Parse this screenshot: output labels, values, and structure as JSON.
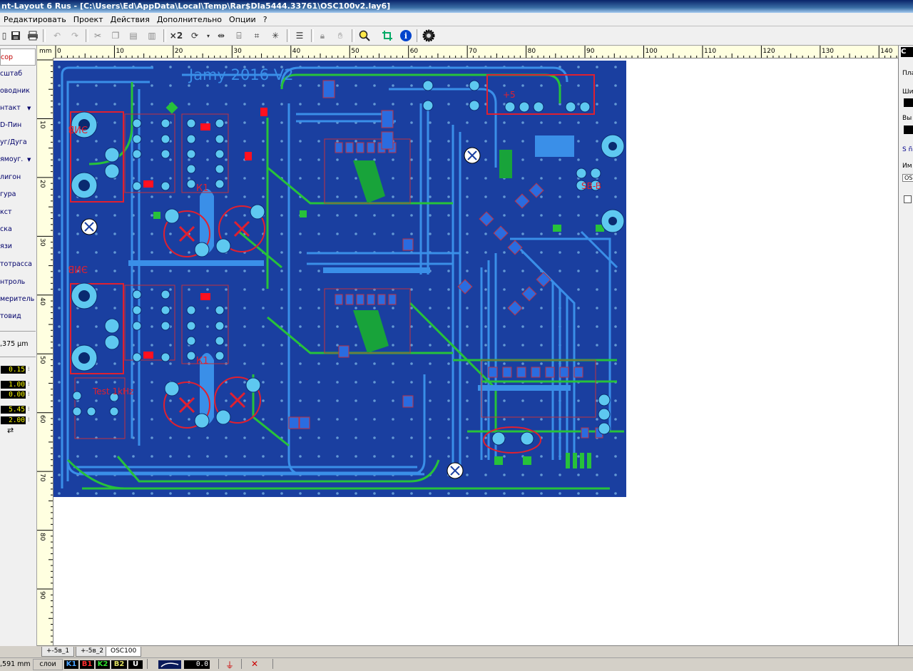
{
  "window": {
    "title": "nt-Layout 6 Rus - [C:\\Users\\Ed\\AppData\\Local\\Temp\\Rar$DIa5444.33761\\OSC100v2.lay6]"
  },
  "menu": [
    "Редактировать",
    "Проект",
    "Действия",
    "Дополнительно",
    "Опции",
    "?"
  ],
  "toolbar": {
    "x2_label": "×2",
    "icons": [
      "save-icon",
      "print-icon",
      "undo-icon",
      "redo-icon",
      "cut-icon",
      "copy-icon",
      "paste-icon",
      "delete-icon",
      "rotate-icon",
      "mirror-icon",
      "group-icon",
      "align-icon",
      "settings-icon",
      "lock-icon",
      "zoom-icon",
      "crop-icon",
      "info-icon",
      "gear-icon"
    ]
  },
  "tools": [
    {
      "label": "сор",
      "active": true
    },
    {
      "label": "сштаб"
    },
    {
      "label": "оводник"
    },
    {
      "label": "нтакт",
      "dropdown": true
    },
    {
      "label": "D-Пин"
    },
    {
      "label": "уг/Дуга"
    },
    {
      "label": "ямоуг.",
      "dropdown": true
    },
    {
      "label": "лигон"
    },
    {
      "label": "гура"
    },
    {
      "label": "кст"
    },
    {
      "label": "ска"
    },
    {
      "label": "язи"
    },
    {
      "label": "тотрасса"
    },
    {
      "label": "нтроль"
    },
    {
      "label": "меритель"
    },
    {
      "label": "товид"
    }
  ],
  "grid_value": ",375 µm",
  "values": [
    "0.15",
    "1.00",
    "0.00",
    "5.45",
    "2.00"
  ],
  "ruler": {
    "unit": "mm",
    "top": [
      "0",
      "10",
      "20",
      "30",
      "40",
      "50",
      "60",
      "70",
      "80",
      "90",
      "100",
      "110",
      "120",
      "130",
      "140"
    ],
    "left": [
      "10",
      "20",
      "30",
      "40",
      "50",
      "60",
      "70",
      "80",
      "90"
    ]
  },
  "board": {
    "title_text": "Jamy 2016 V2",
    "labels": [
      "ЭИВ",
      "ЭИВ",
      "К1",
      "К1",
      "Test 1kHz",
      "SB-B",
      "+5"
    ]
  },
  "right_panel": {
    "head": "C",
    "items": [
      "Пла",
      "Ши",
      "Вы",
      "S ñ",
      "Им",
      "OS"
    ]
  },
  "tabs": [
    "+-5в_1",
    "+-5в_2",
    "OSC100"
  ],
  "status": {
    "coord": ",591 mm",
    "layers_label": "слои",
    "layers": [
      {
        "name": "K1",
        "color": "#4aa3ff"
      },
      {
        "name": "B1",
        "color": "#ff3030"
      },
      {
        "name": "K2",
        "color": "#30e030"
      },
      {
        "name": "B2",
        "color": "#e0e060"
      },
      {
        "name": "U",
        "color": "#ffffff"
      }
    ],
    "value": "0.0"
  }
}
